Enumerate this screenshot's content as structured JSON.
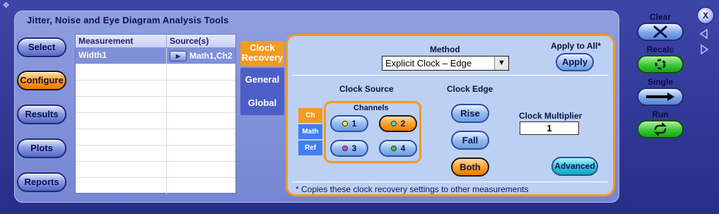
{
  "window": {
    "title": "Jitter, Noise and Eye Diagram Analysis Tools"
  },
  "left_nav": {
    "select": "Select",
    "configure": "Configure",
    "results": "Results",
    "plots": "Plots",
    "reports": "Reports"
  },
  "table": {
    "headers": [
      "Measurement",
      "Source(s)"
    ],
    "rows": [
      {
        "measurement": "Width1",
        "sources": "Math1,Ch2",
        "selected": true
      }
    ]
  },
  "tabs": {
    "clock_recovery": "Clock Recovery",
    "general": "General",
    "global": "Global"
  },
  "settings": {
    "method_label": "Method",
    "method_value": "Explicit Clock – Edge",
    "apply_all_label": "Apply to All*",
    "apply_button": "Apply",
    "clock_source_label": "Clock Source",
    "source_tabs": [
      "Ch",
      "Math",
      "Ref"
    ],
    "channels_label": "Channels",
    "channels": [
      {
        "label": "1",
        "color": "#f4f441",
        "selected": false
      },
      {
        "label": "2",
        "color": "#3fd8e8",
        "selected": true
      },
      {
        "label": "3",
        "color": "#e040e0",
        "selected": false
      },
      {
        "label": "4",
        "color": "#35d035",
        "selected": false
      }
    ],
    "clock_edge_label": "Clock Edge",
    "edge_rise": "Rise",
    "edge_fall": "Fall",
    "edge_both": "Both",
    "multiplier_label": "Clock Multiplier",
    "multiplier_value": "1",
    "advanced_button": "Advanced",
    "footnote": "* Copies these clock recovery settings to other measurements"
  },
  "right_controls": {
    "clear": "Clear",
    "recalc": "Recalc",
    "single": "Single",
    "run": "Run",
    "close": "X"
  },
  "colors": {
    "accent": "#f39a21",
    "panel": "#bcd0f4",
    "frame": "#2d3596"
  }
}
